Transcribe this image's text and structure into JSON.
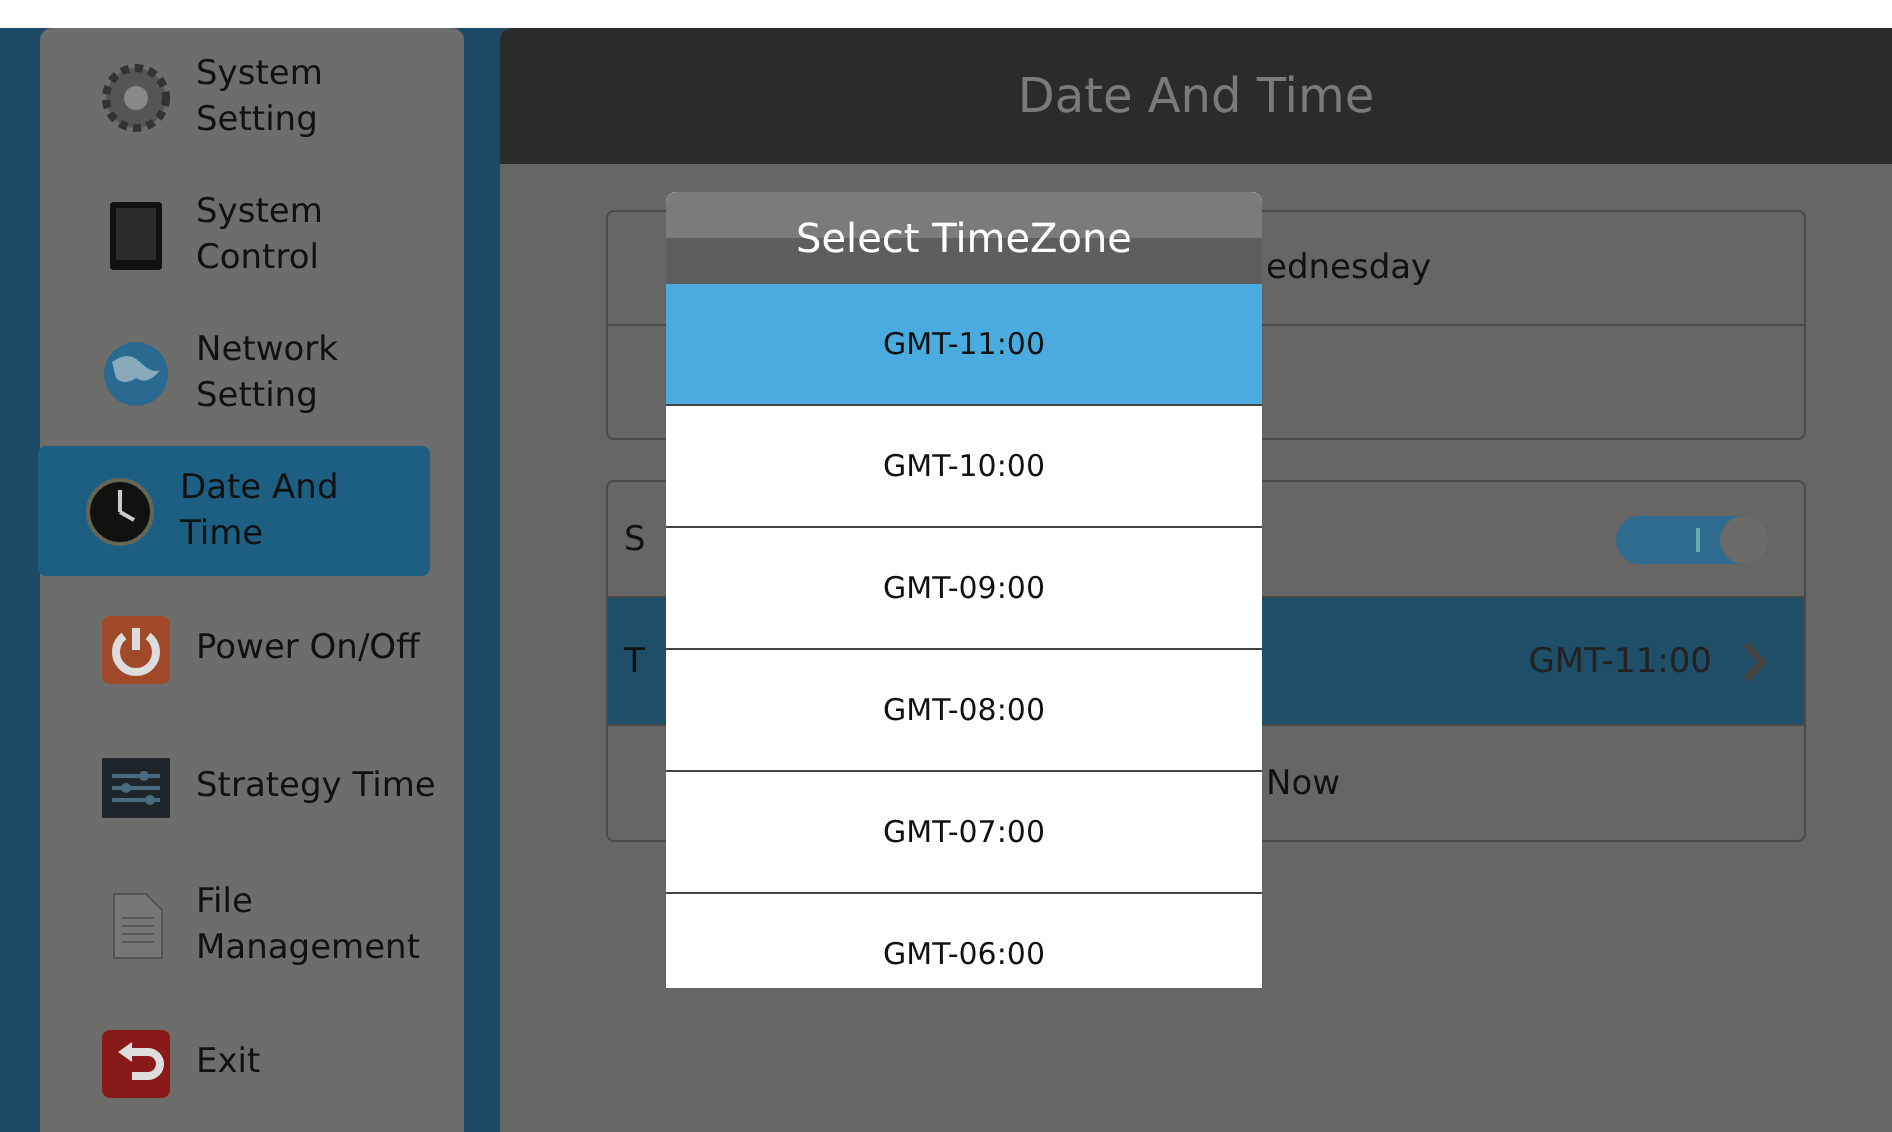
{
  "sidebar": {
    "items": [
      {
        "kind": "gear",
        "label": "System Setting",
        "selected": false
      },
      {
        "kind": "tablet",
        "label": "System Control",
        "selected": false
      },
      {
        "kind": "globe",
        "label": "Network Setting",
        "selected": false
      },
      {
        "kind": "clock",
        "label": "Date And Time",
        "selected": true
      },
      {
        "kind": "power",
        "label": "Power On/Off",
        "selected": false
      },
      {
        "kind": "sliders",
        "label": "Strategy Time",
        "selected": false
      },
      {
        "kind": "file",
        "label": "File Management",
        "selected": false
      },
      {
        "kind": "exit",
        "label": "Exit",
        "selected": false
      }
    ]
  },
  "header": {
    "title": "Date And Time"
  },
  "cards": [
    {
      "rows": [
        {
          "kind": "text",
          "label": "ednesday",
          "selected": false
        },
        {
          "kind": "text",
          "selected": false
        }
      ]
    },
    {
      "rows": [
        {
          "kind": "toggle",
          "label": "S",
          "on": true,
          "selected": false
        },
        {
          "kind": "value",
          "label": "T",
          "value": "GMT-11:00",
          "selected": true
        },
        {
          "kind": "text",
          "label": "Now",
          "selected": false
        }
      ]
    }
  ],
  "dialog": {
    "title": "Select TimeZone",
    "items": [
      {
        "label": "GMT-11:00",
        "selected": true
      },
      {
        "label": "GMT-10:00",
        "selected": false
      },
      {
        "label": "GMT-09:00",
        "selected": false
      },
      {
        "label": "GMT-08:00",
        "selected": false
      },
      {
        "label": "GMT-07:00",
        "selected": false
      },
      {
        "label": "GMT-06:00",
        "selected": false
      }
    ]
  }
}
